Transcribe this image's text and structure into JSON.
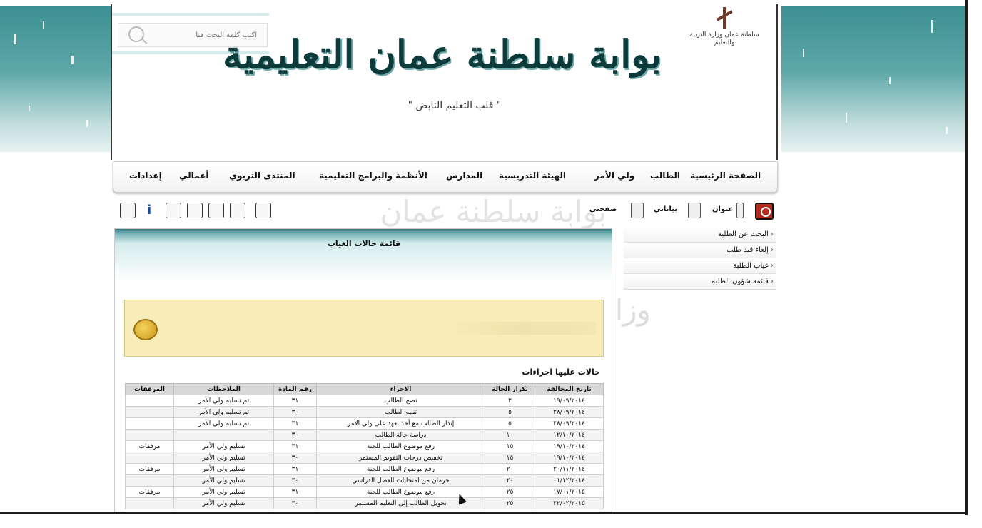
{
  "header": {
    "portal_title": "بوابة سلطنة عمان التعليمية",
    "tagline": "\" قلب التعليم النابض \"",
    "ministry_text": "سلطنة عمان وزارة التربية والتعليم",
    "search": {
      "placeholder": "اكتب كلمة البحث هنا",
      "value": ""
    }
  },
  "nav": {
    "items": [
      {
        "label": "الصفحة الرئيسية"
      },
      {
        "label": "الطالب"
      },
      {
        "label": "ولي الأمر"
      },
      {
        "label": "الهيئة التدريسية"
      },
      {
        "label": "المدارس"
      },
      {
        "label": "الأنظمة والبرامج التعليمية"
      },
      {
        "label": "المنتدى التربوي"
      },
      {
        "label": "أعمالي"
      },
      {
        "label": "إعدادات"
      }
    ]
  },
  "toolbar_right": {
    "address": "عنوان",
    "my_account": "بياناتي",
    "my_page": "صفحتي"
  },
  "side_menu": {
    "items": [
      {
        "label": "البحث عن الطلبة"
      },
      {
        "label": "إلغاء قيد طلب"
      },
      {
        "label": "غياب الطلبة"
      },
      {
        "label": "قائمة شؤون الطلبة"
      }
    ]
  },
  "content": {
    "title": "قائمة حالات الغياب",
    "cases_heading": "حالات عليها اجراءات",
    "table": {
      "headers": [
        "تاريخ المخالفة",
        "تكرار الحالة",
        "الاجراء",
        "رقم المادة",
        "الملاحظات",
        "المرفقات"
      ],
      "rows": [
        [
          "١٩/٠٩/٢٠١٤",
          "٢",
          "نصح الطالب",
          "٣١",
          "تم تسليم ولي الأمر",
          ""
        ],
        [
          "٢٨/٠٩/٢٠١٤",
          "٥",
          "تنبيه الطالب",
          "٣٠",
          "تم تسليم ولي الأمر",
          ""
        ],
        [
          "٢٨/٠٩/٢٠١٤",
          "٥",
          "إنذار الطالب مع أخذ تعهد على ولي الأمر",
          "٣١",
          "تم تسليم ولي الأمر",
          ""
        ],
        [
          "١٢/١٠/٢٠١٤",
          "١٠",
          "دراسة حالة الطالب",
          "٣٠",
          "",
          ""
        ],
        [
          "١٩/١٠/٢٠١٤",
          "١٥",
          "رفع موضوع الطالب للجنة",
          "٣١",
          "تسليم ولي الأمر",
          "مرفقات"
        ],
        [
          "١٩/١٠/٢٠١٤",
          "١٥",
          "تخفيض درجات التقويم المستمر",
          "٣٠",
          "تسليم ولي الأمر",
          ""
        ],
        [
          "٢٠/١١/٢٠١٤",
          "٢٠",
          "رفع موضوع الطالب للجنة",
          "٣١",
          "تسليم ولي الأمر",
          "مرفقات"
        ],
        [
          "٠١/١٢/٢٠١٤",
          "٢٠",
          "حرمان من امتحانات الفصل الدراسي",
          "٣٠",
          "تسليم ولي الأمر",
          ""
        ],
        [
          "١٧/٠١/٢٠١٥",
          "٢٥",
          "رفع موضوع الطالب للجنة",
          "٣١",
          "تسليم ولي الأمر",
          "مرفقات"
        ],
        [
          "٢٢/٠٢/٢٠١٥",
          "٢٥",
          "تحويل الطالب إلى التعليم المستمر",
          "٣٠",
          "تسليم ولي الأمر",
          ""
        ]
      ]
    }
  },
  "colors": {
    "header_band": "#3c8f92",
    "alert_bg": "#f8ecb8",
    "table_header": "#d8d8d8",
    "logout": "#b52a1e"
  }
}
